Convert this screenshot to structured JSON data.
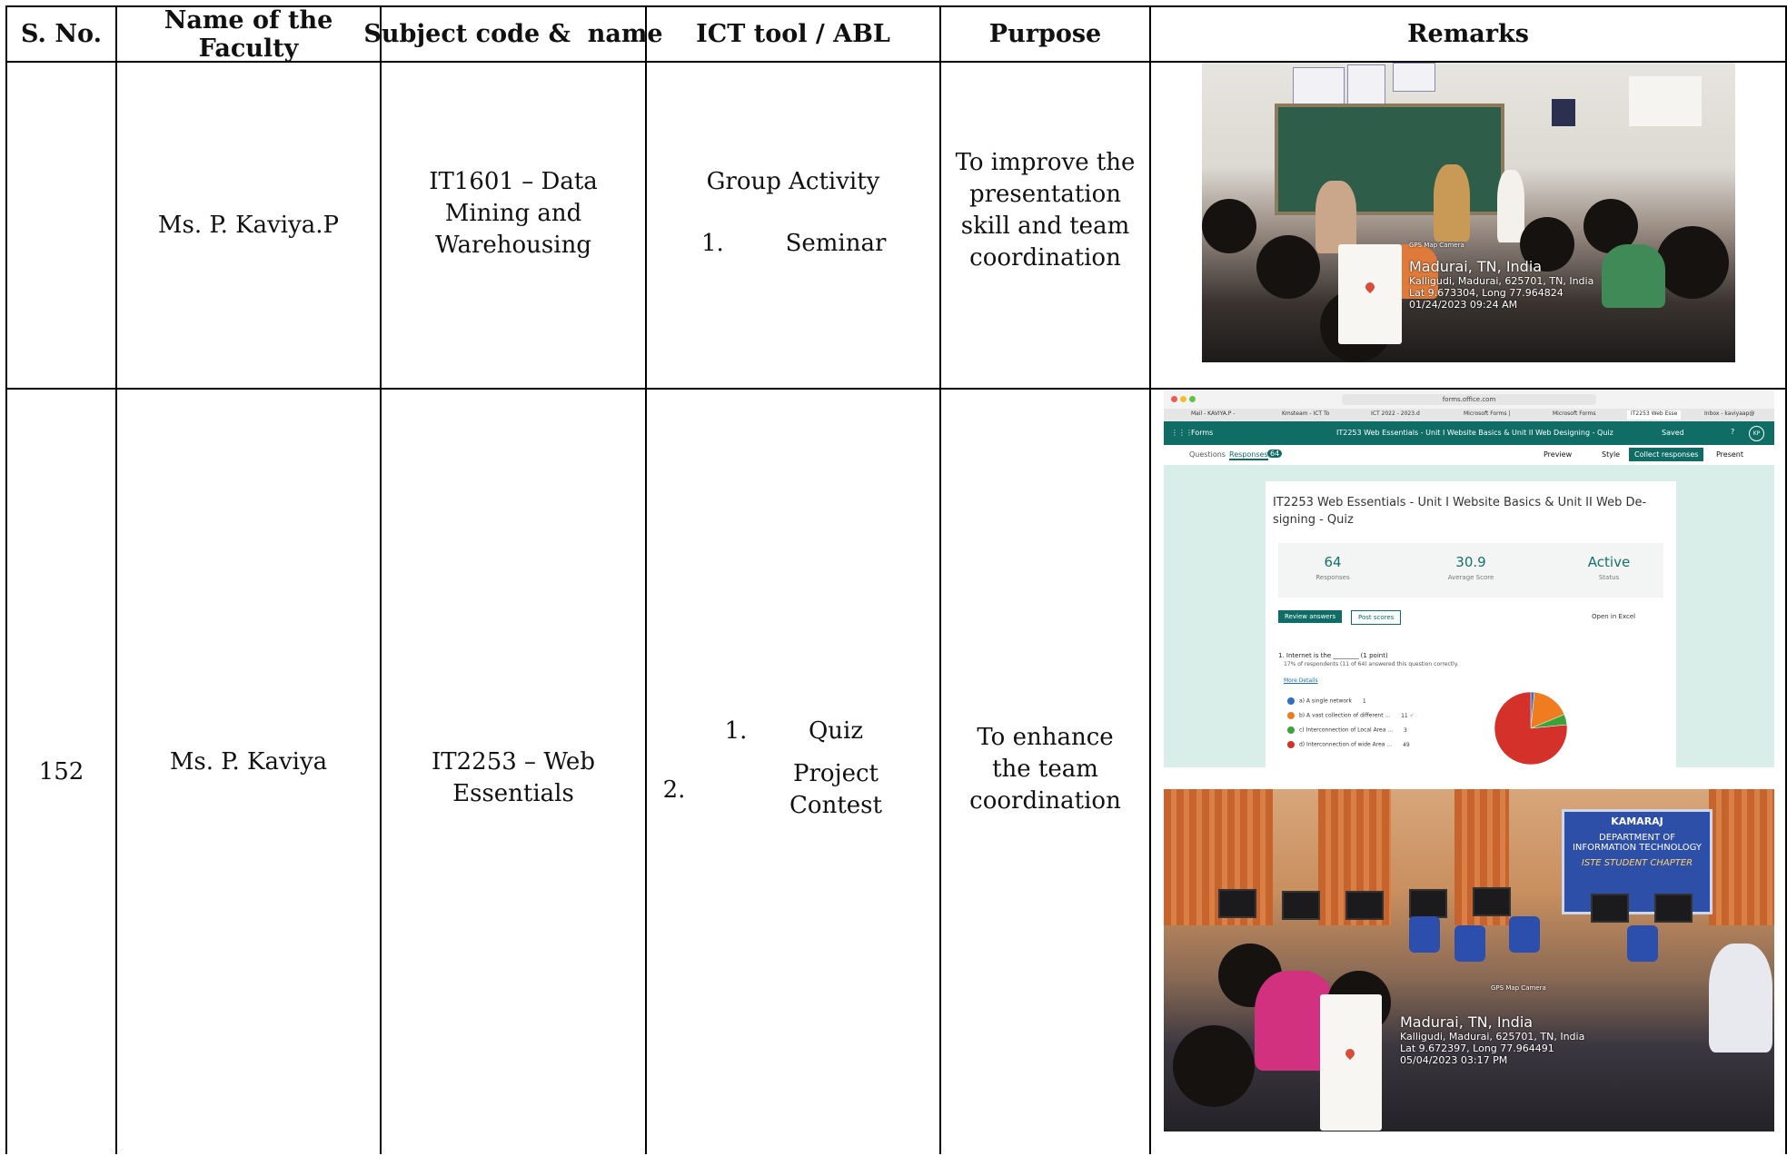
{
  "table": {
    "headers": [
      "S. No.",
      "Name of the Faculty",
      "Subject code &  name",
      "ICT tool / ABL",
      "Purpose",
      "Remarks"
    ],
    "rows": [
      {
        "sno": "",
        "faculty": "Ms. P. Kaviya.P",
        "subject": "IT1601 – Data Mining and Warehousing",
        "ict_title": "Group Activity",
        "ict_items": [
          {
            "num": "1.",
            "label": "Seminar"
          }
        ],
        "purpose": "To improve the presentation skill and team coordination"
      },
      {
        "sno": "152",
        "faculty": "Ms. P. Kaviya",
        "subject": "IT2253 – Web Essentials",
        "ict_items": [
          {
            "num": "1.",
            "label": "Quiz"
          },
          {
            "num": "2.",
            "label": "Project Contest"
          }
        ],
        "purpose": "To enhance the team coordination"
      }
    ]
  },
  "photo1_geotag": {
    "city": "Madurai, TN, India",
    "address": "Kalligudi, Madurai, 625701, TN, India",
    "coords": "Lat 9.673304, Long 77.964824",
    "datetime": "01/24/2023 09:24 AM",
    "app": "GPS Map Camera"
  },
  "forms_screenshot": {
    "url": "forms.office.com",
    "browser_tabs": [
      "Mail - KAVIYA.P -",
      "Kmsteam - ICT To",
      "ICT 2022 - 2023.d",
      "Microsoft Forms |",
      "Microsoft Forms",
      "IT2253 Web Esse",
      "Inbox - kaviyaap@"
    ],
    "app_name": "Forms",
    "doc_title": "IT2253 Web Essentials - Unit I Website Basics & Unit II Web Designing - Quiz",
    "saved": "Saved",
    "avatar": "KP",
    "tab_questions": "Questions",
    "tab_responses": "Responses",
    "responses_badge": "64",
    "preview": "Preview",
    "style": "Style",
    "collect": "Collect responses",
    "present": "Present",
    "form_title": "IT2253 Web Essentials - Unit I Website Basics & Unit II Web De-signing - Quiz",
    "stats": [
      {
        "value": "64",
        "label": "Responses"
      },
      {
        "value": "30.9",
        "label": "Average Score"
      },
      {
        "value": "Active",
        "label": "Status"
      }
    ],
    "review_answers": "Review answers",
    "post_scores": "Post scores",
    "open_excel": "Open in Excel",
    "question": "1.  Internet is the ________ (1 point)",
    "question_note": "17% of respondents (11 of 64) answered this question correctly.",
    "more_details": "More Details",
    "options": [
      {
        "label": "a) A single network",
        "count": "1",
        "color": "#2f6fc6"
      },
      {
        "label": "b) A vast collection of different ...",
        "count": "11",
        "color": "#ef7d1f"
      },
      {
        "label": "c) Interconnection of Local Area ...",
        "count": "3",
        "color": "#3aa33a"
      },
      {
        "label": "d) Interconnection of wide Area ...",
        "count": "49",
        "color": "#d5312b"
      }
    ],
    "colors": {
      "teal": "#0f6d66",
      "bg": "#d9ede9"
    }
  },
  "photo3_banner": {
    "college": "KAMARAJ",
    "dept": "DEPARTMENT OF INFORMATION TECHNOLOGY",
    "chapter": "ISTE STUDENT CHAPTER"
  },
  "photo3_geotag": {
    "city": "Madurai, TN, India",
    "address": "Kalligudi, Madurai, 625701, TN, India",
    "coords": "Lat 9.672397, Long 77.964491",
    "datetime": "05/04/2023 03:17 PM",
    "app": "GPS Map Camera"
  }
}
